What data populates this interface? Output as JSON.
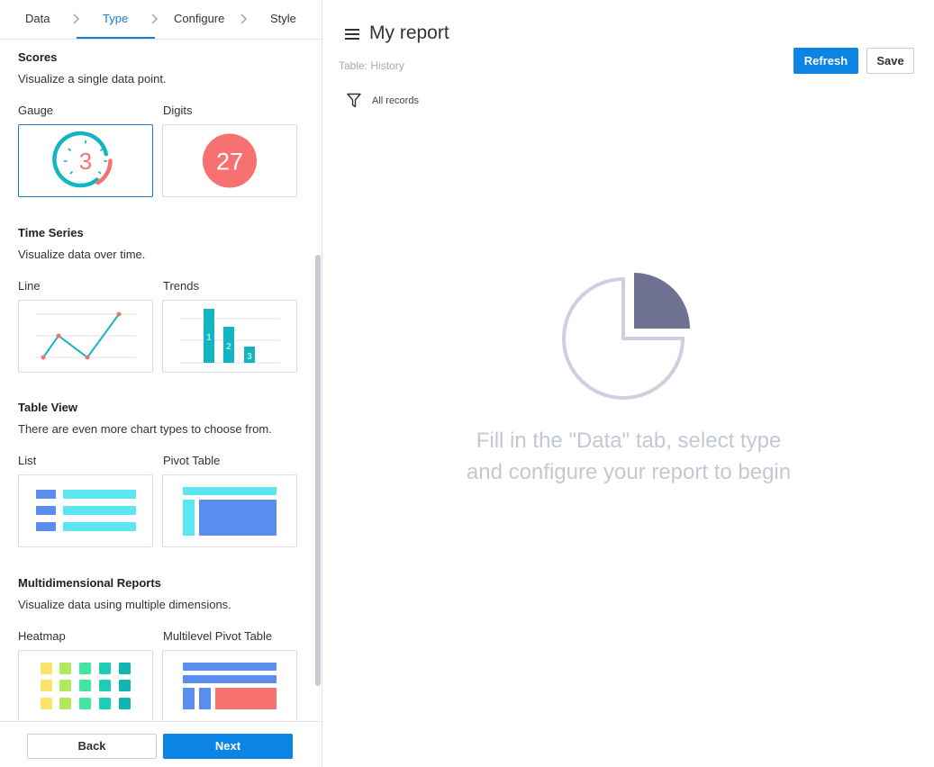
{
  "wizard": {
    "steps": [
      {
        "label": "Data",
        "active": false
      },
      {
        "label": "Type",
        "active": true
      },
      {
        "label": "Configure",
        "active": false
      },
      {
        "label": "Style",
        "active": false
      }
    ],
    "sections": [
      {
        "title": "Scores",
        "description": "Visualize a single data point.",
        "cards": [
          {
            "label": "Gauge",
            "selected": true,
            "preview": "gauge",
            "value": "3"
          },
          {
            "label": "Digits",
            "selected": false,
            "preview": "digits",
            "value": "27"
          }
        ]
      },
      {
        "title": "Time Series",
        "description": "Visualize data over time.",
        "cards": [
          {
            "label": "Line",
            "selected": false,
            "preview": "line"
          },
          {
            "label": "Trends",
            "selected": false,
            "preview": "trends",
            "values": [
              "1",
              "2",
              "3"
            ]
          }
        ]
      },
      {
        "title": "Table View",
        "description": "There are even more chart types to choose from.",
        "cards": [
          {
            "label": "List",
            "selected": false,
            "preview": "list"
          },
          {
            "label": "Pivot Table",
            "selected": false,
            "preview": "pivot-table"
          }
        ]
      },
      {
        "title": "Multidimensional Reports",
        "description": "Visualize data using multiple dimensions.",
        "cards": [
          {
            "label": "Heatmap",
            "selected": false,
            "preview": "heatmap"
          },
          {
            "label": "Multilevel Pivot Table",
            "selected": false,
            "preview": "multilevel-pivot-table"
          }
        ]
      }
    ],
    "footer": {
      "back_label": "Back",
      "next_label": "Next"
    }
  },
  "report": {
    "title": "My report",
    "table_label": "Table: History",
    "refresh_label": "Refresh",
    "save_label": "Save",
    "filter_label": "All records",
    "empty_message_line1": "Fill in the \"Data\" tab, select type",
    "empty_message_line2": "and configure your report to begin"
  },
  "colors": {
    "accent": "#0b84e3",
    "teal": "#13b5c1",
    "coral": "#f87171",
    "chart_muted": "#6e7191",
    "chart_outline": "#cdd1dd"
  }
}
